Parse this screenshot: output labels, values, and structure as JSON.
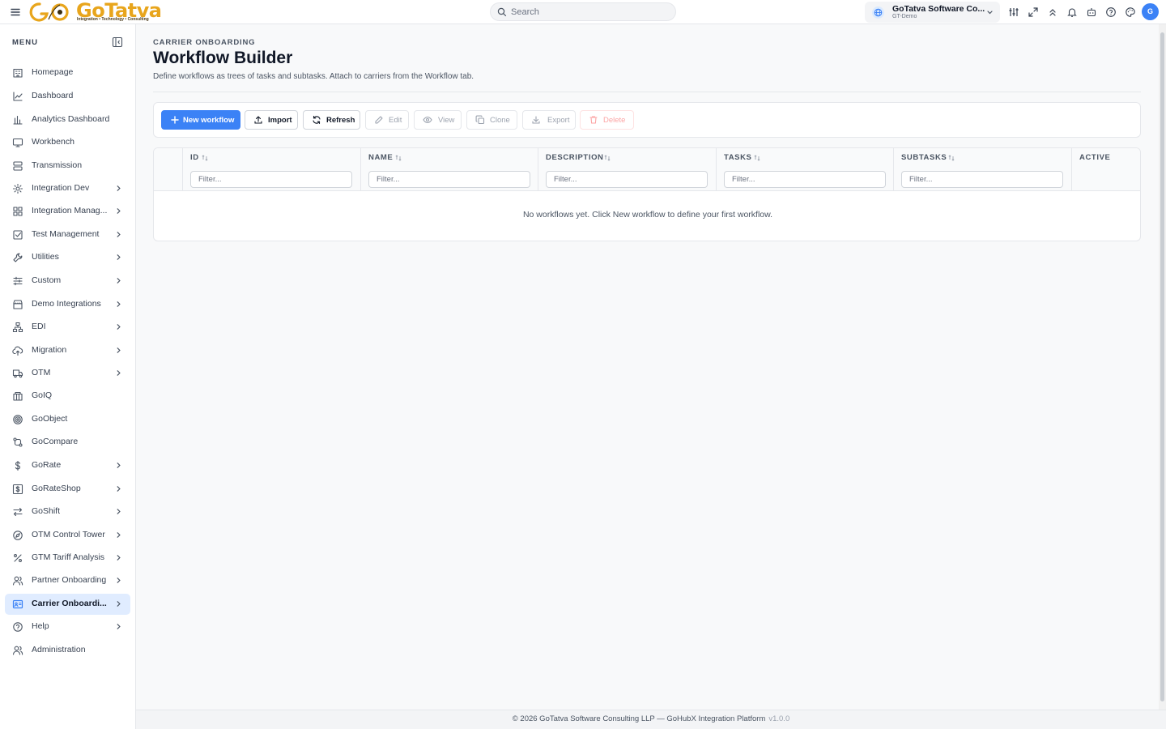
{
  "brand": {
    "logo_word": "GoTatva",
    "tagline": "Integration • Technology • Consulting"
  },
  "search": {
    "placeholder": "Search"
  },
  "org": {
    "name": "GoTatva Software Co...",
    "sub": "GT-Demo"
  },
  "user": {
    "avatar_letter": "G"
  },
  "sidebar": {
    "heading": "MENU",
    "items": [
      {
        "label": "Homepage",
        "icon": "building-icon"
      },
      {
        "label": "Dashboard",
        "icon": "line-chart-icon"
      },
      {
        "label": "Analytics Dashboard",
        "icon": "bar-chart-icon"
      },
      {
        "label": "Workbench",
        "icon": "monitor-icon"
      },
      {
        "label": "Transmission",
        "icon": "server-icon"
      },
      {
        "label": "Integration Dev",
        "icon": "gear-icon"
      },
      {
        "label": "Integration Manag...",
        "icon": "grid-icon"
      },
      {
        "label": "Test Management",
        "icon": "check-square-icon"
      },
      {
        "label": "Utilities",
        "icon": "wrench-icon"
      },
      {
        "label": "Custom",
        "icon": "sliders-icon"
      },
      {
        "label": "Demo Integrations",
        "icon": "store-icon"
      },
      {
        "label": "EDI",
        "icon": "network-icon"
      },
      {
        "label": "Migration",
        "icon": "cloud-upload-icon"
      },
      {
        "label": "OTM",
        "icon": "truck-icon"
      },
      {
        "label": "GoIQ",
        "icon": "columns-icon"
      },
      {
        "label": "GoObject",
        "icon": "target-icon"
      },
      {
        "label": "GoCompare",
        "icon": "git-compare-icon"
      },
      {
        "label": "GoRate",
        "icon": "dollar-icon"
      },
      {
        "label": "GoRateShop",
        "icon": "dollar-square-icon"
      },
      {
        "label": "GoShift",
        "icon": "arrows-swap-icon"
      },
      {
        "label": "OTM Control Tower",
        "icon": "compass-icon"
      },
      {
        "label": "GTM Tariff Analysis",
        "icon": "percent-icon"
      },
      {
        "label": "Partner Onboarding",
        "icon": "users-icon"
      },
      {
        "label": "Carrier Onboardi...",
        "icon": "id-card-icon"
      },
      {
        "label": "Help",
        "icon": "help-circle-icon"
      },
      {
        "label": "Administration",
        "icon": "users-icon"
      }
    ]
  },
  "page": {
    "breadcrumb": "CARRIER ONBOARDING",
    "title": "Workflow Builder",
    "subtitle": "Define workflows as trees of tasks and subtasks. Attach to carriers from the Workflow tab."
  },
  "toolbar": {
    "new_workflow": "New workflow",
    "import": "Import",
    "refresh": "Refresh",
    "edit": "Edit",
    "view": "View",
    "clone": "Clone",
    "export": "Export",
    "delete": "Delete"
  },
  "table": {
    "columns": [
      "ID",
      "NAME",
      "DESCRIPTION",
      "TASKS",
      "SUBTASKS",
      "ACTIVE"
    ],
    "filter_placeholder": "Filter...",
    "empty_message": "No workflows yet. Click New workflow to define your first workflow."
  },
  "footer": {
    "text": "© 2026 GoTatva Software Consulting LLP — GoHubX Integration Platform",
    "version": "v1.0.0"
  },
  "colors": {
    "accent": "#3b82f6",
    "brand": "#e8a51c",
    "active_bg": "#e0ecff"
  }
}
